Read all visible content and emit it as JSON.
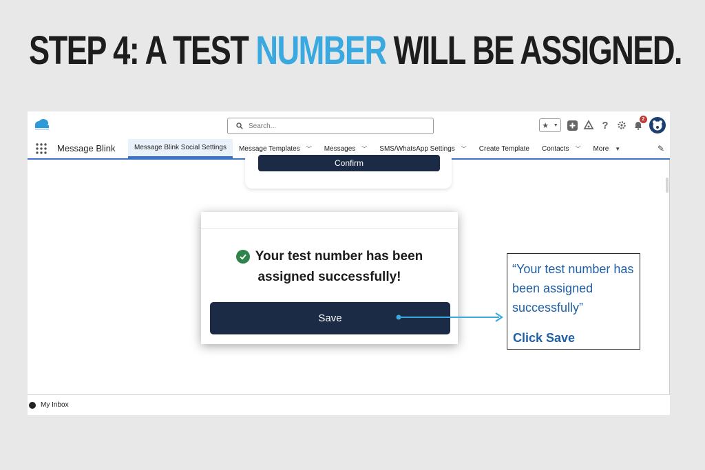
{
  "headline": {
    "part1": "STEP 4: A TEST ",
    "highlight": "NUMBER",
    "part2": " WILL BE ASSIGNED."
  },
  "header": {
    "search_placeholder": "Search...",
    "notification_count": "2"
  },
  "nav": {
    "app_name": "Message Blink",
    "tabs": [
      {
        "label": "Message Blink Social Settings",
        "active": true
      },
      {
        "label": "Message Templates",
        "chevron": true
      },
      {
        "label": "Messages",
        "chevron": true
      },
      {
        "label": "SMS/WhatsApp Settings",
        "chevron": true
      },
      {
        "label": "Create Template"
      },
      {
        "label": "Contacts",
        "chevron": true
      },
      {
        "label": "More"
      }
    ]
  },
  "page": {
    "confirm_label": "Confirm"
  },
  "modal": {
    "line1": "Your test number has been",
    "line2": "assigned successfully!",
    "save_label": "Save"
  },
  "footer": {
    "inbox_label": "My Inbox"
  },
  "callout": {
    "quote": "“Your test number has been assigned successfully”",
    "action": "Click Save"
  },
  "colors": {
    "accent_blue": "#3aa9e0",
    "button_navy": "#1b2b45",
    "success_green": "#2e844a",
    "callout_text": "#1f5fa6"
  }
}
